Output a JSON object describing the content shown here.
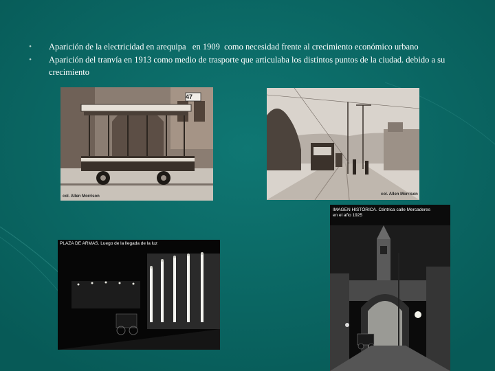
{
  "slide": {
    "bullets": [
      {
        "text": "Aparición de la electricidad en arequipa   en 1909  como necesidad frente al crecimiento económico urbano"
      },
      {
        "text": "Aparición del tranvía en 1913 como medio de trasporte que articulaba los distintos puntos de la ciudad. debido a su crecimiento"
      }
    ],
    "bullet_symbol": "•"
  },
  "photos": {
    "tram_car": {
      "signboard_number": "47",
      "credit": "col. Allen Morrison"
    },
    "tram_street": {
      "credit": "col. Allen Morrison"
    },
    "plaza_night": {
      "caption": "PLAZA DE ARMAS. Luego de la llegada de la luz"
    },
    "mercaderes": {
      "caption": "IMAGEN HISTÓRICA. Céntrica calle Mercaderes en el año 1925"
    }
  },
  "colors": {
    "background": "#0b6b67",
    "text": "#ffffff"
  }
}
